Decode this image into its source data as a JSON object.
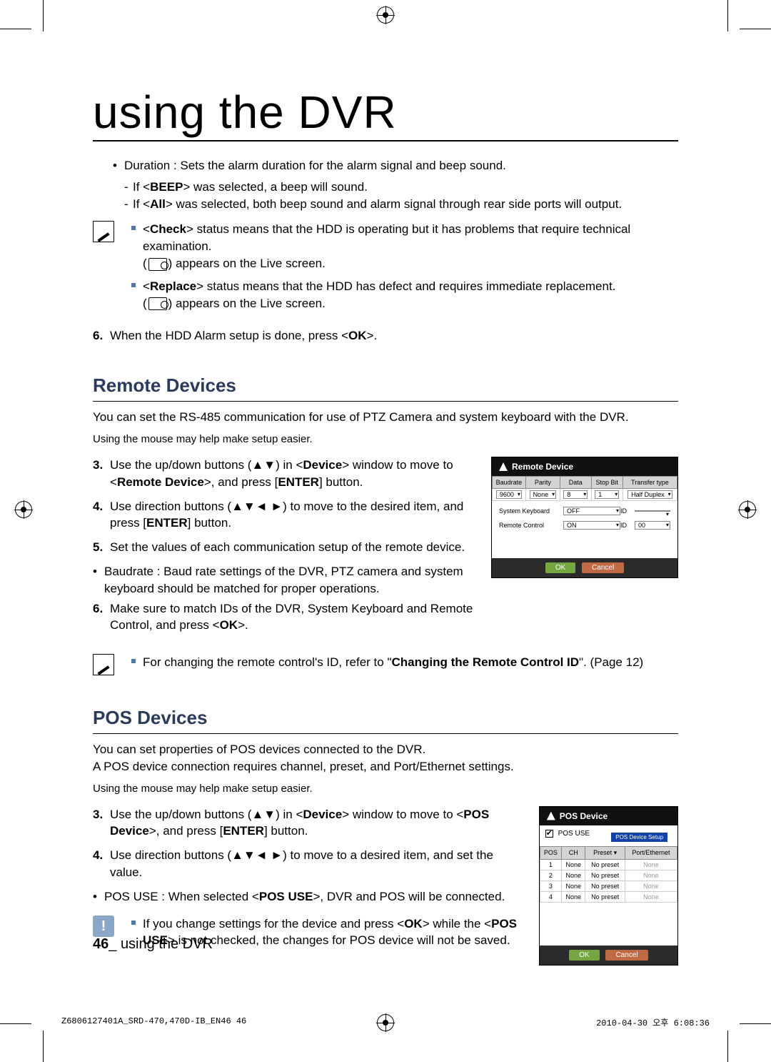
{
  "title": "using the DVR",
  "alarm_bullet": "Duration : Sets the alarm duration for the alarm signal and beep sound.",
  "alarm_sub1_pre": "If <",
  "alarm_sub1_bold": "BEEP",
  "alarm_sub1_post": "> was selected, a beep will sound.",
  "alarm_sub2_pre": "If <",
  "alarm_sub2_bold": "All",
  "alarm_sub2_post": "> was selected, both beep sound and alarm signal through rear side ports will output.",
  "note1": {
    "a_pre": "<",
    "a_bold": "Check",
    "a_post": "> status means that the HDD is operating but it has problems that require technical examination.",
    "a_post2": ") appears on the Live screen.",
    "b_pre": "<",
    "b_bold": "Replace",
    "b_post": "> status means that the HDD has defect and requires immediate replacement.",
    "b_post2": ") appears on the Live screen."
  },
  "step6_num": "6.",
  "step6_a": "When the HDD Alarm setup is done, press <",
  "step6_b": "OK",
  "step6_c": ">.",
  "remote": {
    "heading": "Remote Devices",
    "intro": "You can set the RS-485 communication for use of PTZ Camera and system keyboard with the DVR.",
    "mouse": "Using the mouse may help make setup easier.",
    "s3_num": "3.",
    "s3_a": "Use the up/down buttons (▲▼) in <",
    "s3_b": "Device",
    "s3_c": "> window to move to <",
    "s3_d": "Remote Device",
    "s3_e": ">, and press [",
    "s3_f": "ENTER",
    "s3_g": "] button.",
    "s4_num": "4.",
    "s4_a": "Use direction buttons (▲▼◄ ►) to move to the desired item, and press [",
    "s4_b": "ENTER",
    "s4_c": "] button.",
    "s5_num": "5.",
    "s5": "Set the values of each communication setup of the remote device.",
    "b1": "Baudrate : Baud rate settings of the DVR, PTZ camera and system keyboard should be matched for proper operations.",
    "s6_num": "6.",
    "s6_a": "Make sure to match IDs of the DVR, System Keyboard and Remote Control, and press <",
    "s6_b": "OK",
    "s6_c": ">.",
    "note_a": "For changing the remote control's ID, refer to \"",
    "note_b": "Changing the Remote Control ID",
    "note_c": "\". (Page 12)"
  },
  "remote_panel": {
    "title": "Remote Device",
    "cols": [
      "Baudrate",
      "Parity",
      "Data",
      "Stop Bit",
      "Transfer type"
    ],
    "vals": [
      "9600",
      "None",
      "8",
      "1",
      "Half Duplex"
    ],
    "row1_label": "System Keyboard",
    "row1_state": "OFF",
    "row1_id_label": "ID",
    "row1_id": "",
    "row2_label": "Remote Control",
    "row2_state": "ON",
    "row2_id_label": "ID",
    "row2_id": "00",
    "ok": "OK",
    "cancel": "Cancel"
  },
  "pos": {
    "heading": "POS Devices",
    "intro1": "You can set properties of POS devices connected to the DVR.",
    "intro2": "A POS device connection requires channel, preset, and Port/Ethernet settings.",
    "mouse": "Using the mouse may help make setup easier.",
    "s3_num": "3.",
    "s3_a": "Use the up/down buttons (▲▼) in <",
    "s3_b": "Device",
    "s3_c": "> window to move to <",
    "s3_d": "POS Device",
    "s3_e": ">, and press [",
    "s3_f": "ENTER",
    "s3_g": "] button.",
    "s4_num": "4.",
    "s4": "Use direction buttons (▲▼◄ ►) to move to a desired item, and set the value.",
    "b1_a": "POS USE : When selected <",
    "b1_b": "POS USE",
    "b1_c": ">, DVR and POS will be connected.",
    "warn_a": "If you change settings for the device and press <",
    "warn_b": "OK",
    "warn_c": "> while the <",
    "warn_d": "POS USE",
    "warn_e": "> is not checked, the changes for POS device will not be saved."
  },
  "pos_panel": {
    "title": "POS Device",
    "use_label": "POS USE",
    "setup_btn": "POS Device Setup",
    "cols": [
      "POS",
      "CH",
      "Preset ▾",
      "Port/Ethernet"
    ],
    "rows": [
      {
        "pos": "1",
        "ch": "None",
        "preset": "No preset",
        "port": "None"
      },
      {
        "pos": "2",
        "ch": "None",
        "preset": "No preset",
        "port": "None"
      },
      {
        "pos": "3",
        "ch": "None",
        "preset": "No preset",
        "port": "None"
      },
      {
        "pos": "4",
        "ch": "None",
        "preset": "No preset",
        "port": "None"
      }
    ],
    "ok": "OK",
    "cancel": "Cancel"
  },
  "footer_page": "46",
  "footer_sep": "_ ",
  "footer_text": "using the DVR",
  "print_l": "Z6806127401A_SRD-470,470D-IB_EN46   46",
  "print_r": "2010-04-30   오후 6:08:36"
}
